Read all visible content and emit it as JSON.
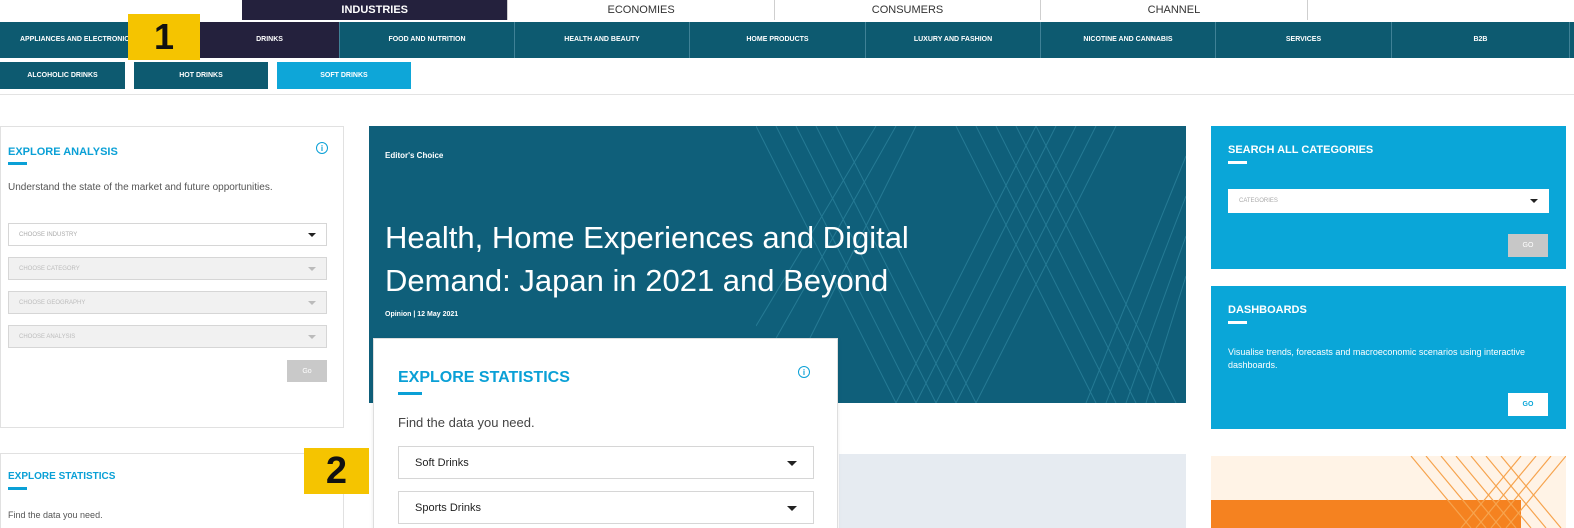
{
  "top_tabs": [
    {
      "label": "INDUSTRIES",
      "active": true
    },
    {
      "label": "ECONOMIES",
      "active": false
    },
    {
      "label": "CONSUMERS",
      "active": false
    },
    {
      "label": "CHANNEL",
      "active": false
    },
    {
      "label": "",
      "active": false
    }
  ],
  "industry_bar": [
    {
      "label": "APPLIANCES AND ELECTRONICS"
    },
    {
      "label": ""
    },
    {
      "label": "DRINKS"
    },
    {
      "label": "FOOD AND NUTRITION"
    },
    {
      "label": "HEALTH AND BEAUTY"
    },
    {
      "label": "HOME PRODUCTS"
    },
    {
      "label": "LUXURY AND FASHION"
    },
    {
      "label": "NICOTINE AND CANNABIS"
    },
    {
      "label": "SERVICES"
    },
    {
      "label": "B2B"
    }
  ],
  "sub_tabs": [
    {
      "label": "ALCOHOLIC DRINKS"
    },
    {
      "label": "HOT DRINKS"
    },
    {
      "label": "SOFT DRINKS"
    }
  ],
  "callouts": {
    "one": "1",
    "two": "2"
  },
  "explore_analysis": {
    "title": "EXPLORE ANALYSIS",
    "info": "i",
    "description": "Understand the state of the market and future opportunities.",
    "selects": [
      "CHOOSE INDUSTRY",
      "CHOOSE CATEGORY",
      "CHOOSE GEOGRAPHY",
      "CHOOSE ANALYSIS"
    ],
    "go": "Go"
  },
  "explore_statistics_small": {
    "title": "EXPLORE STATISTICS",
    "description": "Find the data you need."
  },
  "hero": {
    "kicker": "Editor's Choice",
    "title": "Health, Home Experiences and Digital Demand: Japan in 2021 and Beyond",
    "meta": "Opinion | 12 May 2021"
  },
  "explore_statistics": {
    "title": "EXPLORE STATISTICS",
    "info": "i",
    "description": "Find the data you need.",
    "selects": [
      "Soft Drinks",
      "Sports Drinks"
    ]
  },
  "search_all": {
    "title": "SEARCH ALL CATEGORIES",
    "select": "CATEGORIES",
    "go": "GO"
  },
  "dashboards": {
    "title": "DASHBOARDS",
    "description": "Visualise trends, forecasts and macroeconomic scenarios using interactive dashboards.",
    "go": "GO"
  },
  "colors": {
    "navy": "#24213d",
    "teal": "#0d5a70",
    "accent_blue": "#0aa6d8",
    "callout_yellow": "#f5c400"
  }
}
